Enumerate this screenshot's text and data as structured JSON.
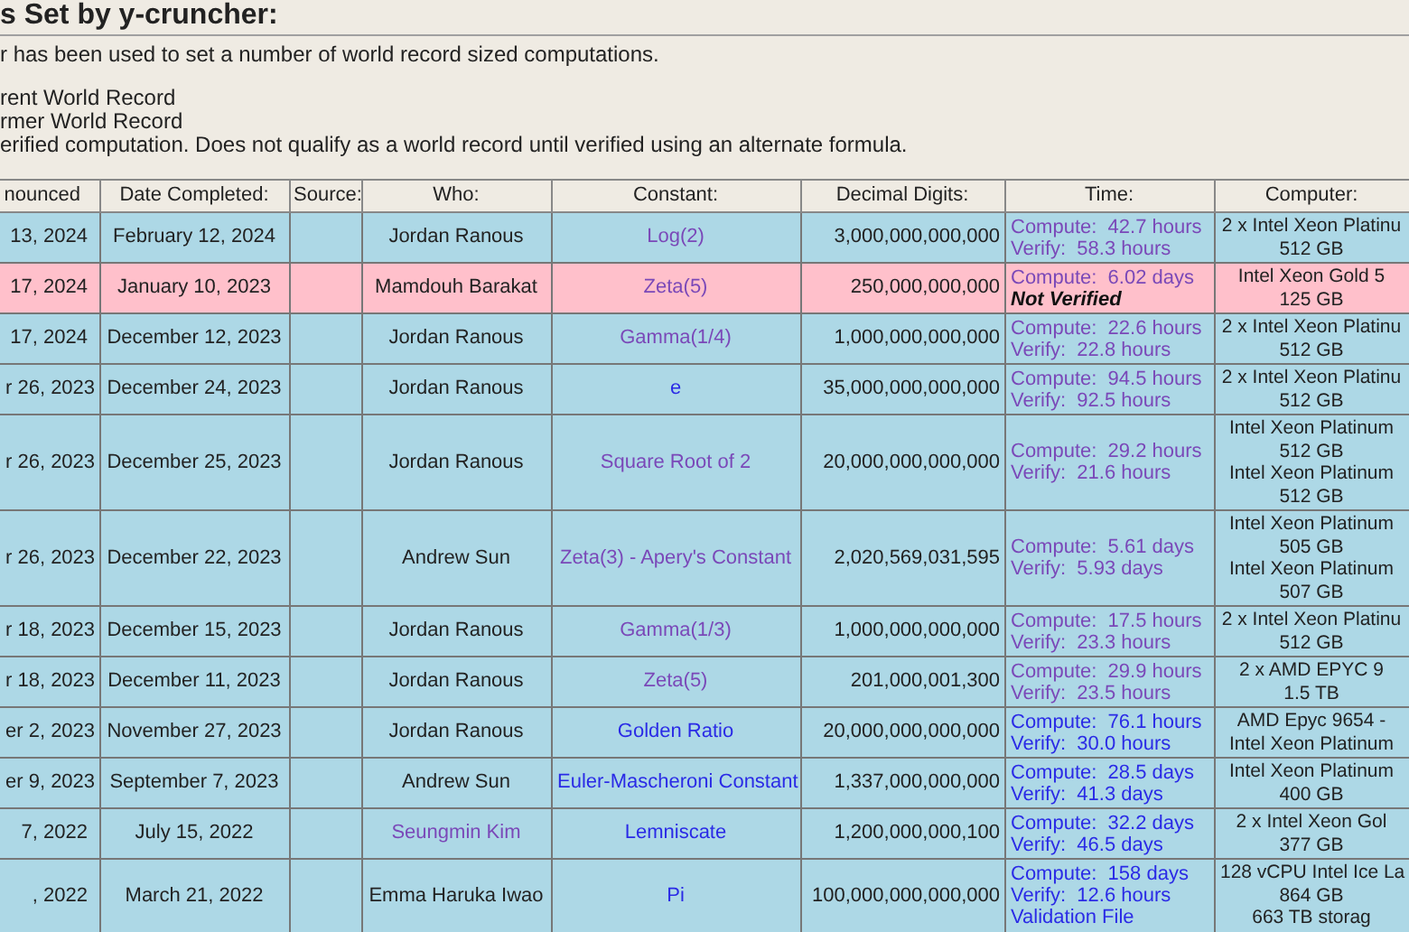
{
  "heading": "s Set by y-cruncher:",
  "intro": "r has been used to set a number of world record sized computations.",
  "legend": [
    "rent World Record",
    "rmer World Record",
    "erified computation. Does not qualify as a world record until verified using an alternate formula."
  ],
  "table": {
    "columns": [
      "nounced",
      "Date Completed:",
      "Source:",
      "Who:",
      "Constant:",
      "Decimal Digits:",
      "Time:",
      "Computer:"
    ],
    "rows": [
      {
        "kind": "verified",
        "announced": "13, 2024",
        "completed": "February 12, 2024",
        "who": {
          "kind": "plain",
          "text": "Jordan Ranous"
        },
        "constant": {
          "kind": "visited_link",
          "text": "Log(2)"
        },
        "digits": "3,000,000,000,000",
        "time": [
          {
            "kind": "visited_link",
            "text": "Compute:  42.7 hours"
          },
          {
            "kind": "visited_link",
            "text": "Verify:  58.3 hours"
          }
        ],
        "computer": [
          "2 x Intel Xeon Platinu",
          "512 GB"
        ]
      },
      {
        "kind": "unverified",
        "announced": "17, 2024",
        "completed": "January 10, 2023",
        "who": {
          "kind": "plain",
          "text": "Mamdouh Barakat"
        },
        "constant": {
          "kind": "visited_link",
          "text": "Zeta(5)"
        },
        "digits": "250,000,000,000",
        "time": [
          {
            "kind": "visited_link",
            "text": "Compute:  6.02 days"
          },
          {
            "kind": "note",
            "text": "Not Verified"
          }
        ],
        "computer": [
          "Intel Xeon Gold 5",
          "125 GB"
        ]
      },
      {
        "kind": "verified",
        "announced": "17, 2024",
        "completed": "December 12, 2023",
        "who": {
          "kind": "plain",
          "text": "Jordan Ranous"
        },
        "constant": {
          "kind": "visited_link",
          "text": "Gamma(1/4)"
        },
        "digits": "1,000,000,000,000",
        "time": [
          {
            "kind": "visited_link",
            "text": "Compute:  22.6 hours"
          },
          {
            "kind": "visited_link",
            "text": "Verify:  22.8 hours"
          }
        ],
        "computer": [
          "2 x Intel Xeon Platinu",
          "512 GB"
        ]
      },
      {
        "kind": "verified",
        "announced": "r 26, 2023",
        "completed": "December 24, 2023",
        "who": {
          "kind": "plain",
          "text": "Jordan Ranous"
        },
        "constant": {
          "kind": "link",
          "text": "e"
        },
        "digits": "35,000,000,000,000",
        "time": [
          {
            "kind": "visited_link",
            "text": "Compute:  94.5 hours"
          },
          {
            "kind": "visited_link",
            "text": "Verify:  92.5 hours"
          }
        ],
        "computer": [
          "2 x Intel Xeon Platinu",
          "512 GB"
        ]
      },
      {
        "kind": "verified",
        "announced": "r 26, 2023",
        "completed": "December 25, 2023",
        "who": {
          "kind": "plain",
          "text": "Jordan Ranous"
        },
        "constant": {
          "kind": "visited_link",
          "text": "Square Root of 2"
        },
        "digits": "20,000,000,000,000",
        "time": [
          {
            "kind": "visited_link",
            "text": "Compute:  29.2 hours"
          },
          {
            "kind": "visited_link",
            "text": "Verify:  21.6 hours"
          }
        ],
        "computer": [
          "Intel Xeon Platinum",
          "512 GB",
          "Intel Xeon Platinum",
          "512 GB"
        ]
      },
      {
        "kind": "verified",
        "announced": "r 26, 2023",
        "completed": "December 22, 2023",
        "who": {
          "kind": "plain",
          "text": "Andrew Sun"
        },
        "constant": {
          "kind": "visited_link",
          "text": "Zeta(3) - Apery's Constant"
        },
        "digits": "2,020,569,031,595",
        "time": [
          {
            "kind": "visited_link",
            "text": "Compute:  5.61 days"
          },
          {
            "kind": "visited_link",
            "text": "Verify:  5.93 days"
          }
        ],
        "computer": [
          "Intel Xeon Platinum",
          "505 GB",
          "Intel Xeon Platinum",
          "507 GB"
        ]
      },
      {
        "kind": "verified",
        "announced": "r 18, 2023",
        "completed": "December 15, 2023",
        "who": {
          "kind": "plain",
          "text": "Jordan Ranous"
        },
        "constant": {
          "kind": "visited_link",
          "text": "Gamma(1/3)"
        },
        "digits": "1,000,000,000,000",
        "time": [
          {
            "kind": "visited_link",
            "text": "Compute:  17.5 hours"
          },
          {
            "kind": "visited_link",
            "text": "Verify:  23.3 hours"
          }
        ],
        "computer": [
          "2 x Intel Xeon Platinu",
          "512 GB"
        ]
      },
      {
        "kind": "verified",
        "announced": "r 18, 2023",
        "completed": "December 11, 2023",
        "who": {
          "kind": "plain",
          "text": "Jordan Ranous"
        },
        "constant": {
          "kind": "visited_link",
          "text": "Zeta(5)"
        },
        "digits": "201,000,001,300",
        "time": [
          {
            "kind": "visited_link",
            "text": "Compute:  29.9 hours"
          },
          {
            "kind": "visited_link",
            "text": "Verify:  23.5 hours"
          }
        ],
        "computer": [
          "2 x AMD EPYC 9",
          "1.5 TB"
        ]
      },
      {
        "kind": "verified",
        "announced": "er 2, 2023",
        "completed": "November 27, 2023",
        "who": {
          "kind": "plain",
          "text": "Jordan Ranous"
        },
        "constant": {
          "kind": "link",
          "text": "Golden Ratio"
        },
        "digits": "20,000,000,000,000",
        "time": [
          {
            "kind": "link",
            "text": "Compute:  76.1 hours"
          },
          {
            "kind": "link",
            "text": "Verify:  30.0 hours"
          }
        ],
        "computer": [
          "AMD Epyc 9654 -",
          "Intel Xeon Platinum"
        ]
      },
      {
        "kind": "verified",
        "announced": "er 9, 2023",
        "completed": "September 7, 2023",
        "who": {
          "kind": "plain",
          "text": "Andrew Sun"
        },
        "constant": {
          "kind": "link",
          "text": "Euler-Mascheroni Constant"
        },
        "digits": "1,337,000,000,000",
        "time": [
          {
            "kind": "link",
            "text": "Compute:  28.5 days"
          },
          {
            "kind": "link",
            "text": "Verify:  41.3 days"
          }
        ],
        "computer": [
          "Intel Xeon Platinum",
          "400 GB"
        ]
      },
      {
        "kind": "verified",
        "announced": "7, 2022",
        "completed": "July 15, 2022",
        "who": {
          "kind": "visited_link",
          "text": "Seungmin Kim"
        },
        "constant": {
          "kind": "link",
          "text": "Lemniscate"
        },
        "digits": "1,200,000,000,100",
        "time": [
          {
            "kind": "link",
            "text": "Compute:  32.2 days"
          },
          {
            "kind": "link",
            "text": "Verify:  46.5 days"
          }
        ],
        "computer": [
          "2 x Intel Xeon Gol",
          "377 GB"
        ]
      },
      {
        "kind": "verified",
        "announced": ", 2022",
        "completed": "March 21, 2022",
        "who": {
          "kind": "plain",
          "text": "Emma Haruka Iwao"
        },
        "constant": {
          "kind": "link",
          "text": "Pi"
        },
        "digits": "100,000,000,000,000",
        "time": [
          {
            "kind": "link",
            "text": "Compute:  158 days"
          },
          {
            "kind": "link",
            "text": "Verify:  12.6 hours"
          },
          {
            "kind": "link",
            "text": "Validation File"
          }
        ],
        "computer": [
          "128 vCPU Intel Ice La",
          "864 GB",
          "663 TB storag"
        ]
      }
    ]
  }
}
